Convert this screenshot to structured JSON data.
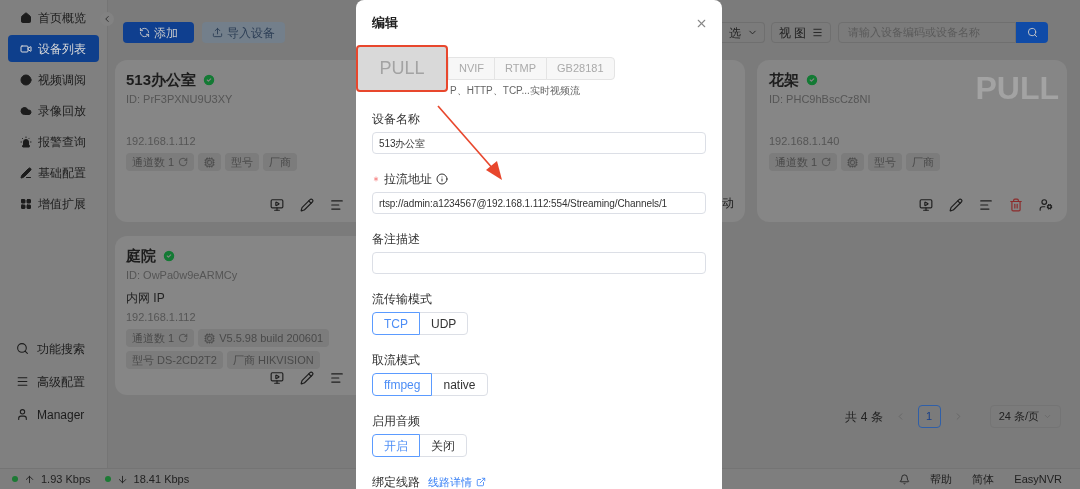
{
  "sidebar": {
    "items": [
      {
        "label": "首页概览",
        "selected": false
      },
      {
        "label": "设备列表",
        "selected": true
      },
      {
        "label": "视频调阅",
        "selected": false
      },
      {
        "label": "录像回放",
        "selected": false
      },
      {
        "label": "报警查询",
        "selected": false
      },
      {
        "label": "基础配置",
        "selected": false
      },
      {
        "label": "增值扩展",
        "selected": false
      }
    ],
    "bottom_items": [
      {
        "label": "功能搜索",
        "kind": "search"
      },
      {
        "label": "高级配置",
        "kind": "menu"
      },
      {
        "label": "Manager",
        "kind": "user"
      }
    ]
  },
  "toolbar": {
    "add_button": "添加",
    "import_button": "导入设备",
    "filter_button": "选",
    "view_button": "视 图",
    "search": {
      "placeholder": "请输入设备编码或设备名称"
    }
  },
  "left_cards": [
    {
      "name": "513办公室",
      "online": true,
      "id": "ID: PrF3PXNU9U3XY",
      "ip": "192.168.1.112",
      "tags": [
        {
          "kind": "channels",
          "text": "通道数 1"
        },
        {
          "kind": "firmware"
        },
        {
          "kind": "plain",
          "text": "型号"
        },
        {
          "kind": "plain",
          "text": "厂商"
        }
      ],
      "actions": [
        {
          "kind": "play"
        },
        {
          "kind": "edit"
        },
        {
          "kind": "details"
        }
      ]
    },
    {
      "name": "庭院",
      "online": true,
      "id": "ID: OwPa0w9eARMCy",
      "network": "内网 IP",
      "ip": "192.168.1.112",
      "tags": [
        {
          "kind": "channels",
          "text": "通道数 1"
        },
        {
          "kind": "firmware",
          "text": "V5.5.98 build 200601"
        },
        {
          "kind": "plain",
          "text": "型号 DS-2CD2T2"
        },
        {
          "kind": "plain",
          "text": "厂商 HIKVISION"
        }
      ],
      "actions": [
        {
          "kind": "play"
        },
        {
          "kind": "edit"
        },
        {
          "kind": "details"
        }
      ]
    }
  ],
  "middle_card_fragment": "动",
  "right_cards": [
    {
      "name": "花架",
      "online": true,
      "id": "ID: PHC9hBscCz8NI",
      "badge_text": "PULL",
      "ip": "192.168.1.140",
      "tags": [
        {
          "kind": "channels",
          "text": "通道数 1"
        },
        {
          "kind": "firmware"
        },
        {
          "kind": "plain",
          "text": "型号"
        },
        {
          "kind": "plain",
          "text": "厂商"
        }
      ],
      "actions": [
        {
          "kind": "play"
        },
        {
          "kind": "edit"
        },
        {
          "kind": "details"
        },
        {
          "kind": "delete"
        },
        {
          "kind": "user"
        }
      ]
    }
  ],
  "pagination": {
    "total": "共 4 条",
    "pages": [
      {
        "label": "1",
        "selected": true
      }
    ],
    "page_size": "24 条/页"
  },
  "status_bar": {
    "upload": "1.93 Kbps",
    "download": "18.41 Kbps",
    "links": [
      "帮助",
      "简体",
      "EasyNVR"
    ]
  },
  "modal": {
    "title": "编辑",
    "callout": "PULL",
    "access_types": [
      "NVIF",
      "RTMP",
      "GB28181"
    ],
    "access_hint": "P、HTTP、TCP...实时视频流",
    "fields": [
      {
        "kind": "text",
        "label": "设备名称",
        "value": "513办公室"
      },
      {
        "kind": "text",
        "label": "拉流地址",
        "required": true,
        "info": true,
        "value": "rtsp://admin:a1234567@192.168.1.112:554/Streaming/Channels/1"
      },
      {
        "kind": "text",
        "label": "备注描述"
      },
      {
        "kind": "segmented",
        "label": "流传输模式",
        "options": [
          {
            "label": "TCP",
            "selected": true
          },
          {
            "label": "UDP",
            "selected": false
          }
        ]
      },
      {
        "kind": "segmented",
        "label": "取流模式",
        "options": [
          {
            "label": "ffmpeg",
            "selected": true
          },
          {
            "label": "native",
            "selected": false
          }
        ]
      },
      {
        "kind": "segmented",
        "label": "启用音频",
        "options": [
          {
            "label": "开启",
            "selected": true
          },
          {
            "label": "关闭",
            "selected": false
          }
        ]
      },
      {
        "kind": "link",
        "label": "绑定线路",
        "link": "线路详情"
      }
    ]
  }
}
